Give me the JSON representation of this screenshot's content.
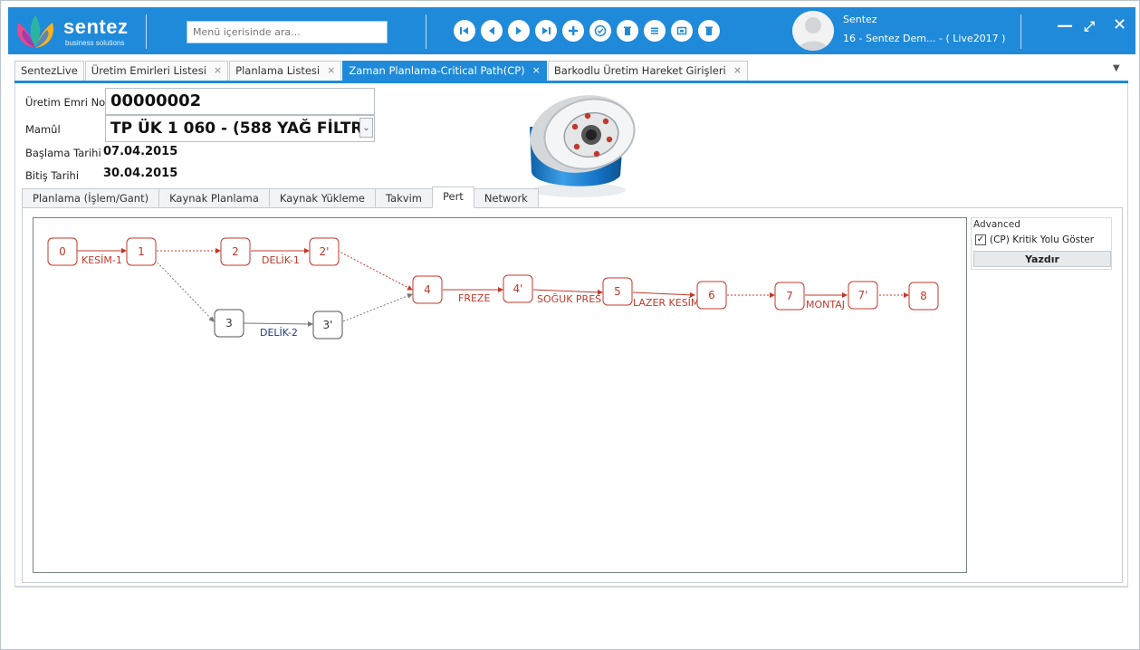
{
  "header": {
    "logo_text": "sentez",
    "logo_sub": "business solutions",
    "search_placeholder": "Menü içerisinde ara...",
    "nav_icons": [
      "first-icon",
      "previous-icon",
      "next-icon",
      "last-icon",
      "add-icon",
      "approve-icon",
      "delete-icon",
      "list-icon",
      "window-icon",
      "trash-icon"
    ],
    "user_name": "Sentez",
    "user_company": "16 - Sentez Dem... - ( Live2017 )",
    "colors": {
      "bar": "#1f8ad9"
    }
  },
  "doc_tabs": [
    {
      "label": "SentezLive"
    },
    {
      "label": "Üretim Emirleri Listesi",
      "close": "×"
    },
    {
      "label": "Planlama Listesi",
      "close": "×"
    },
    {
      "label": "Zaman Planlama-Critical Path(CP)",
      "close": "×",
      "active": true
    },
    {
      "label": "Barkodlu Üretim Hareket Girişleri",
      "close": "×"
    }
  ],
  "form": {
    "order_no_label": "Üretim Emri No",
    "order_no": "00000002",
    "product_label": "Mamûl",
    "product": "TP ÜK 1 060 - (588 YAĞ FİLTRESİ)",
    "start_label": "Başlama Tarihi",
    "start_date": "07.04.2015",
    "end_label": "Bitiş Tarihi",
    "end_date": "30.04.2015"
  },
  "inner_tabs": [
    {
      "label": "Planlama (İşlem/Gant)"
    },
    {
      "label": "Kaynak Planlama"
    },
    {
      "label": "Kaynak Yükleme"
    },
    {
      "label": "Takvim"
    },
    {
      "label": "Pert",
      "active": true
    },
    {
      "label": "Network"
    }
  ],
  "pert": {
    "nodes": [
      "0",
      "1",
      "2",
      "2'",
      "3",
      "3'",
      "4",
      "4'",
      "5",
      "6",
      "7",
      "7'",
      "8"
    ],
    "edge_labels": [
      "KESİM-1",
      "DELİK-1",
      "DELİK-2",
      "FREZE",
      "SOĞUK PRES",
      "LAZER KESİM",
      "MONTAJ"
    ],
    "colors": {
      "critical": "#c0392b",
      "normal": "#444444",
      "non_critical_label": "#1a3a8a"
    }
  },
  "advanced": {
    "title": "Advanced",
    "critical_path_label": "(CP) Kritik Yolu Göster",
    "critical_path_checked": true,
    "print_label": "Yazdır"
  }
}
